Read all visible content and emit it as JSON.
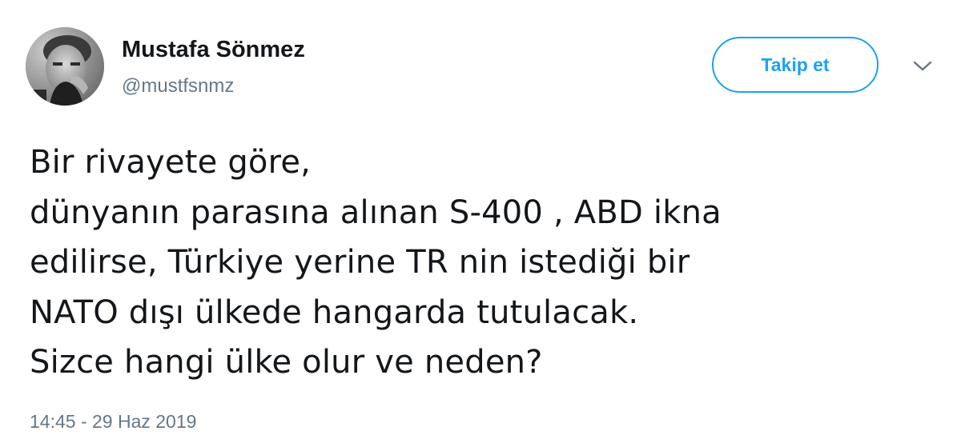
{
  "author": {
    "display_name": "Mustafa Sönmez",
    "handle": "@mustfsnmz",
    "avatar_icon": "profile-photo"
  },
  "actions": {
    "follow_label": "Takip et",
    "more_icon": "chevron-down-icon"
  },
  "tweet": {
    "lines": [
      "Bir rivayete göre,",
      "dünyanın parasına alınan S-400 , ABD ikna",
      "edilirse, Türkiye yerine TR nin istediği bir",
      "NATO dışı ülkede hangarda tutulacak.",
      "Sizce hangi ülke olur ve neden?"
    ],
    "timestamp": "14:45 - 29 Haz 2019"
  },
  "colors": {
    "accent": "#1da1f2",
    "text_primary": "#14171a",
    "text_secondary": "#657786",
    "background": "#ffffff"
  }
}
